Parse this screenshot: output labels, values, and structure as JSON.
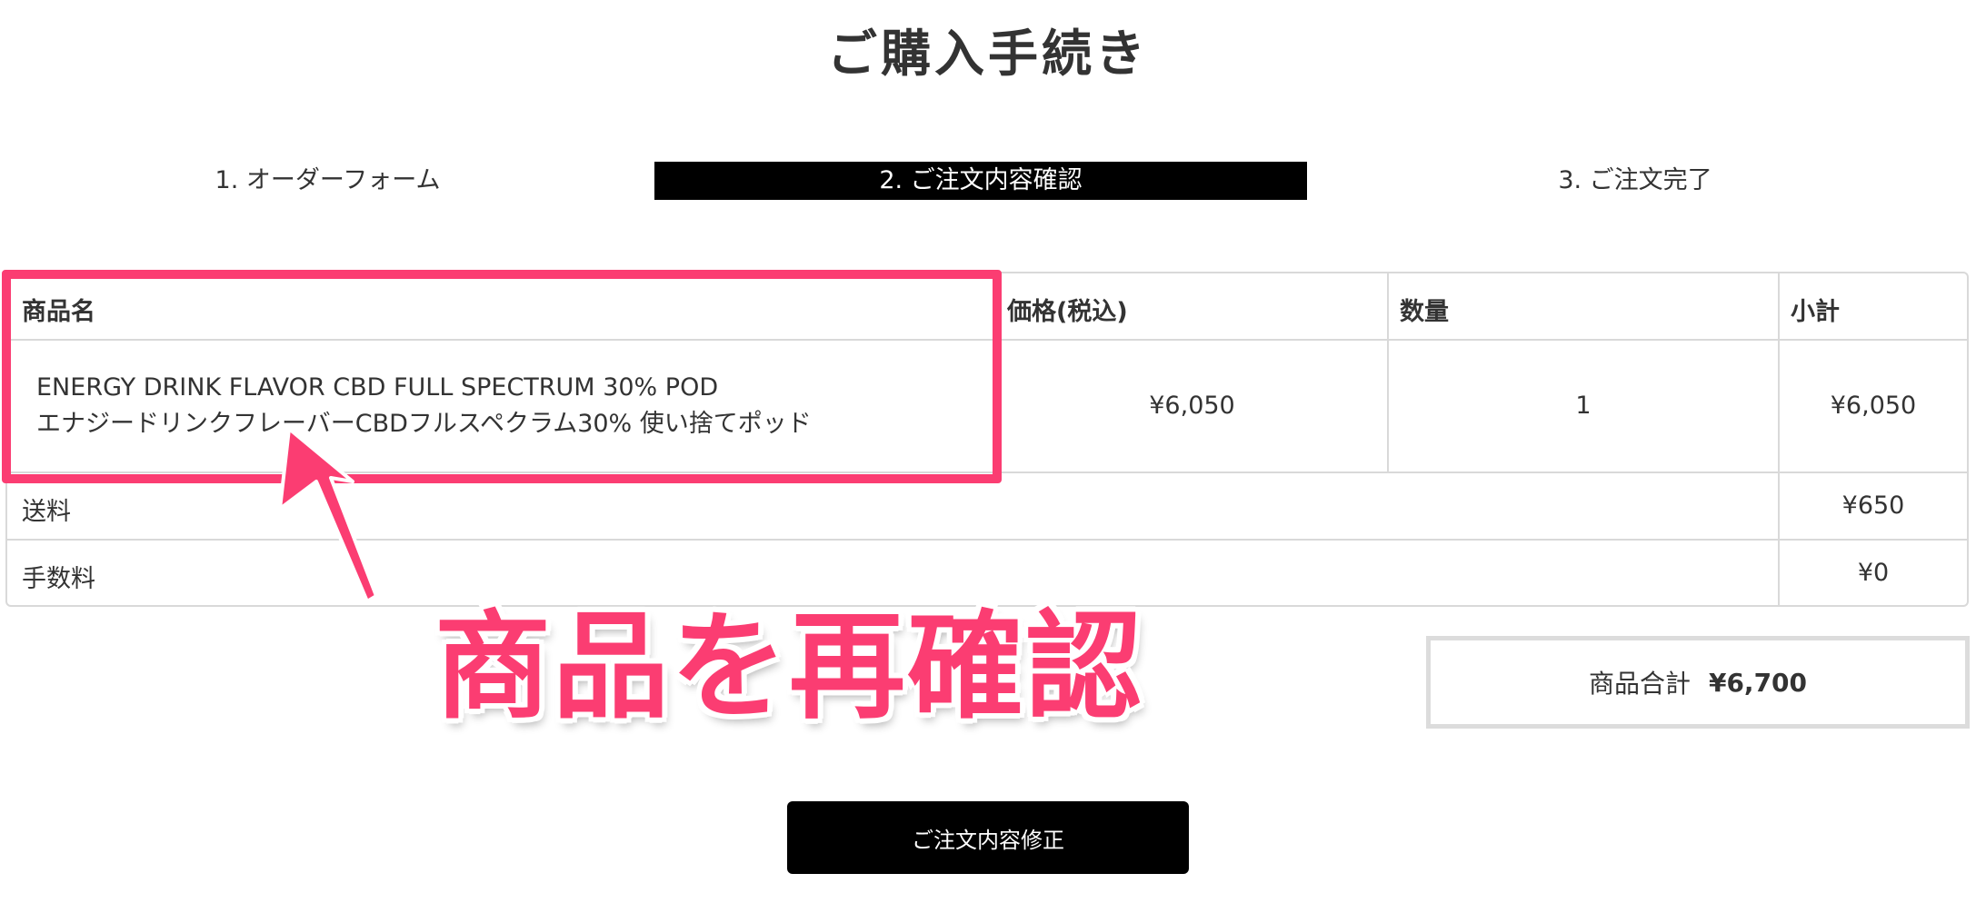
{
  "page": {
    "title": "ご購入手続き"
  },
  "steps": [
    {
      "label": "1. オーダーフォーム",
      "active": false
    },
    {
      "label": "2. ご注文内容確認",
      "active": true
    },
    {
      "label": "3. ご注文完了",
      "active": false
    }
  ],
  "cart": {
    "headers": {
      "product": "商品名",
      "price": "価格(税込)",
      "qty": "数量",
      "subtotal": "小計"
    },
    "item": {
      "name_line1": "ENERGY DRINK FLAVOR CBD FULL SPECTRUM 30% POD",
      "name_line2": "エナジードリンクフレーバーCBDフルスペクラム30% 使い捨てポッド",
      "price": "¥6,050",
      "qty": "1",
      "subtotal": "¥6,050"
    },
    "shipping": {
      "label": "送料",
      "value": "¥650"
    },
    "fee": {
      "label": "手数料",
      "value": "¥0"
    }
  },
  "total": {
    "label": "商品合計",
    "value": "¥6,700"
  },
  "buttons": {
    "edit_order": "ご注文内容修正"
  },
  "annotation": {
    "text": "商品を再確認",
    "color": "#fb3d72"
  }
}
